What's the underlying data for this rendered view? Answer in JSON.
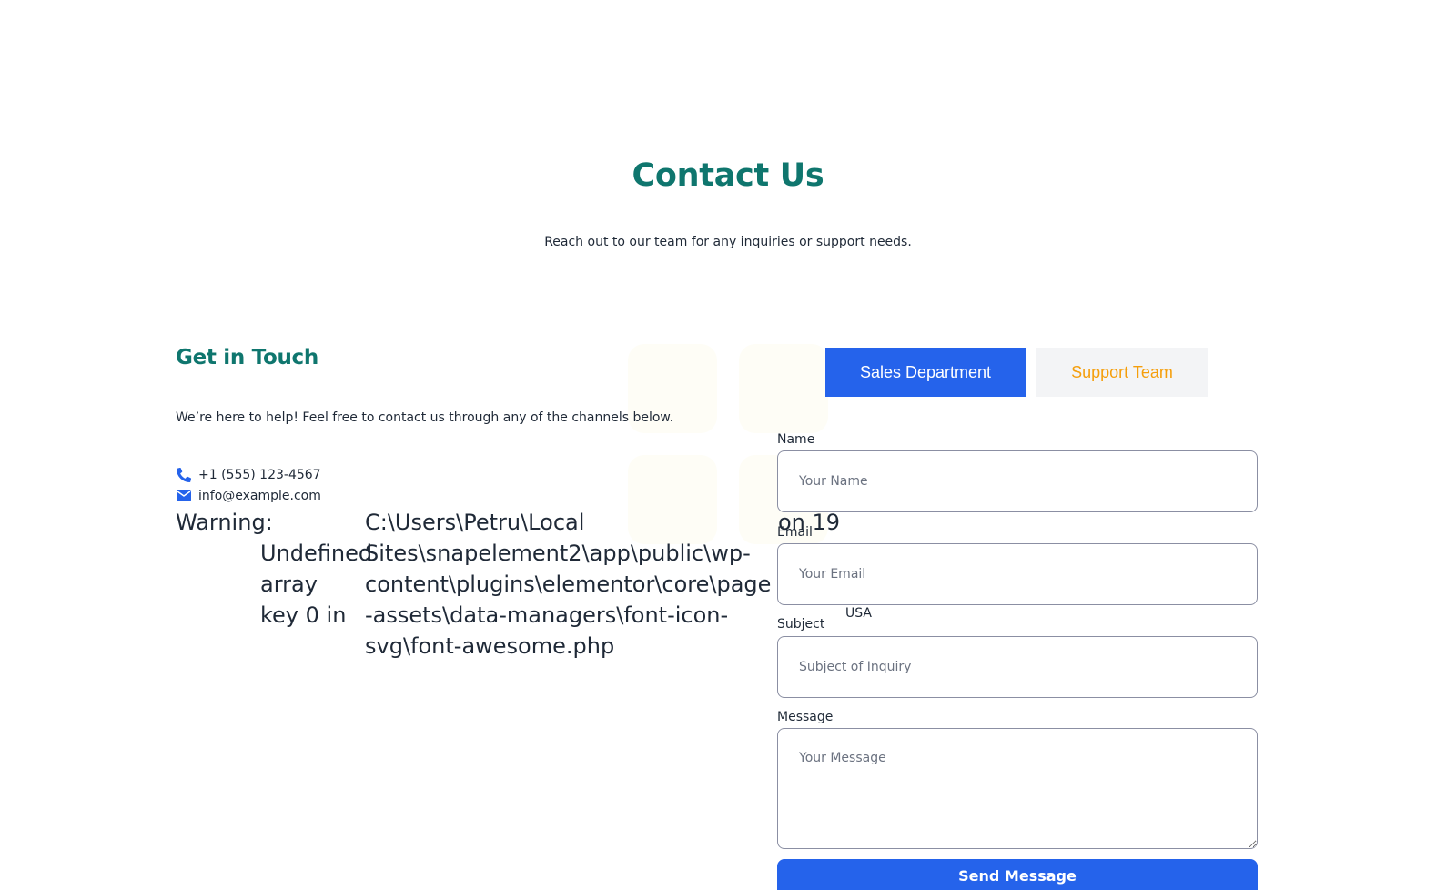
{
  "hero": {
    "title": "Contact Us",
    "subtitle": "Reach out to our team for any inquiries or support needs."
  },
  "info": {
    "title": "Get in Touch",
    "description": "We’re here to help! Feel free to contact us through any of the channels below.",
    "phone": "+1 (555) 123-4567",
    "email": "info@example.com",
    "phone_icon": "phone-icon",
    "email_icon": "envelope-icon"
  },
  "warning": {
    "label": "Warning:",
    "message": "Undefined array key 0 in",
    "path": "C:\\Users\\Petru\\Local Sites\\snapelement2\\app\\public\\wp-content\\plugins\\elementor\\core\\page-assets\\data-managers\\font-icon-svg\\font-awesome.php",
    "line": "on 19"
  },
  "tabs": [
    {
      "label": "Sales Department",
      "active": true
    },
    {
      "label": "Support Team",
      "active": false
    }
  ],
  "form": {
    "name_label": "Name",
    "name_placeholder": "Your Name",
    "email_label": "Email",
    "email_placeholder": "Your Email",
    "subject_label": "Subject",
    "subject_placeholder": "Subject of Inquiry",
    "message_label": "Message",
    "message_placeholder": "Your Message",
    "location": "USA",
    "submit_label": "Send Message"
  },
  "colors": {
    "brand_teal": "#0f766e",
    "primary_blue": "#2563eb",
    "tab_inactive_bg": "#f3f4f6",
    "tab_inactive_text": "#f59e0b"
  }
}
